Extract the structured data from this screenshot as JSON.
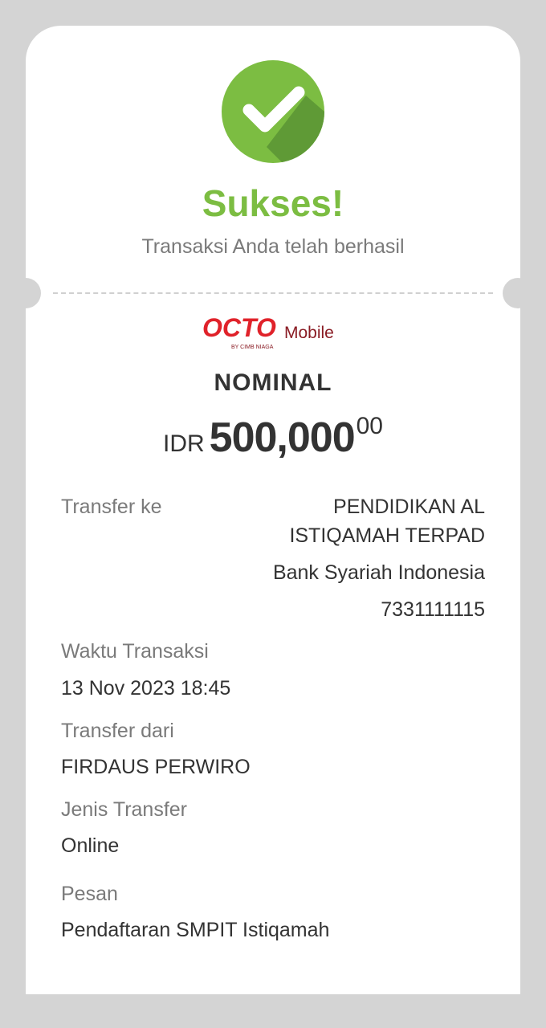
{
  "header": {
    "status_title": "Sukses!",
    "status_message": "Transaksi Anda telah berhasil",
    "success_icon": "check-circle-icon",
    "accent_color": "#7cbd42"
  },
  "brand": {
    "logo_word": "OCTO",
    "logo_suffix": "Mobile",
    "logo_byline": "BY CIMB NIAGA",
    "brand_color": "#e0222a"
  },
  "amount": {
    "label": "NOMINAL",
    "currency": "IDR",
    "integer_part": "500,000",
    "decimal_part": "00"
  },
  "details": {
    "transfer_to": {
      "label": "Transfer ke",
      "name_line1": "PENDIDIKAN AL",
      "name_line2": "ISTIQAMAH TERPAD",
      "bank": "Bank Syariah Indonesia",
      "account_number": "7331111115"
    },
    "transaction_time": {
      "label": "Waktu Transaksi",
      "value": "13 Nov 2023 18:45"
    },
    "transfer_from": {
      "label": "Transfer dari",
      "value": "FIRDAUS PERWIRO"
    },
    "transfer_type": {
      "label": "Jenis Transfer",
      "value": "Online"
    },
    "message": {
      "label": "Pesan",
      "value": "Pendaftaran SMPIT Istiqamah"
    }
  }
}
